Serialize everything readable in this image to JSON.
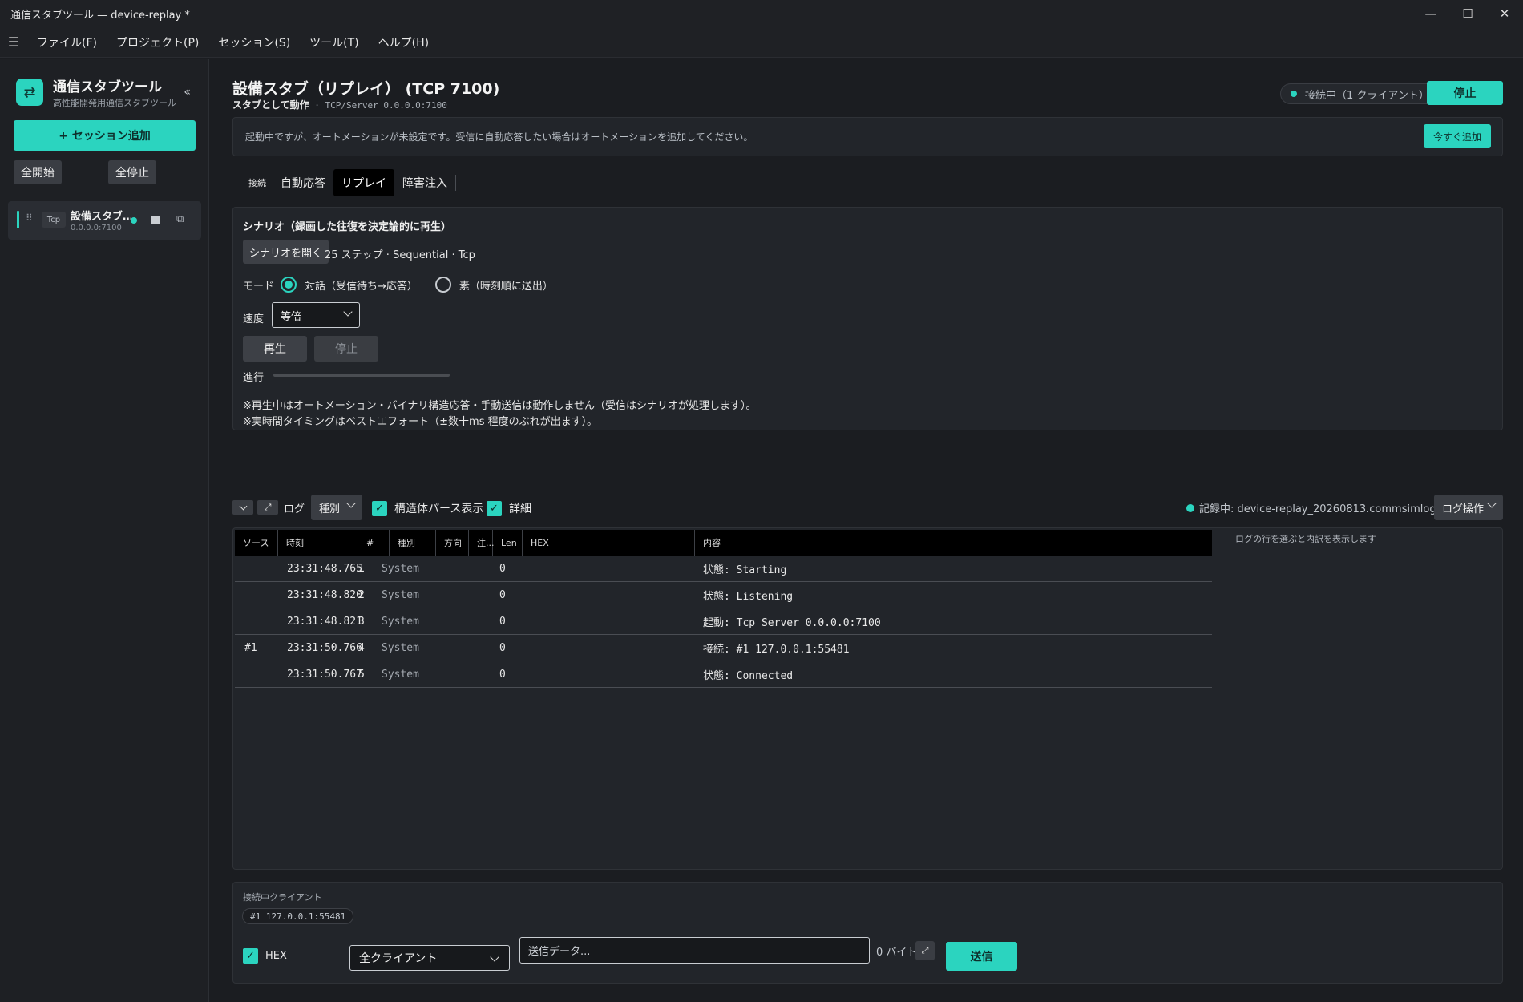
{
  "window": {
    "title": "通信スタブツール — device-replay *",
    "controls": [
      "—",
      "☐",
      "✕"
    ]
  },
  "menu": [
    "ファイル(F)",
    "プロジェクト(P)",
    "セッション(S)",
    "ツール(T)",
    "ヘルプ(H)"
  ],
  "sidebar": {
    "brand_title": "通信スタブツール",
    "brand_sub": "高性能開発用通信スタブツール",
    "collapse": "«",
    "add_session": "+ セッション追加",
    "start_all": "全開始",
    "stop_all": "全停止",
    "session": {
      "proto": "Tcp",
      "name": "設備スタブ…",
      "addr": "0.0.0.0:7100"
    }
  },
  "header": {
    "title": "設備スタブ（リプレイ） (TCP 7100)",
    "sub_bold": "スタブとして動作",
    "sub_endpoint": " · TCP/Server 0.0.0.0:7100",
    "status": "接続中（1 クライアント）",
    "stop": "停止"
  },
  "notice": {
    "text": "起動中ですが、オートメーションが未設定です。受信に自動応答したい場合はオートメーションを追加してください。",
    "button": "今すぐ追加"
  },
  "tabs": [
    "接続",
    "自動応答",
    "リプレイ",
    "障害注入"
  ],
  "replay": {
    "title": "シナリオ（録画した往復を決定論的に再生）",
    "open_button": "シナリオを開く",
    "scenario_info": "25 ステップ · Sequential · Tcp",
    "mode_label": "モード",
    "mode_dialog": "対話（受信待ち→応答）",
    "mode_raw": "素（時刻順に送出）",
    "speed_label": "速度",
    "speed_value": "等倍",
    "play": "再生",
    "stop": "停止",
    "progress_label": "進行",
    "progress": 0,
    "note1": "※再生中はオートメーション・バイナリ構造応答・手動送信は動作しません（受信はシナリオが処理します）。",
    "note2": "※実時間タイミングはベストエフォート（±数十ms 程度のぶれが出ます）。"
  },
  "log": {
    "label": "ログ",
    "kind_filter": "種別",
    "struct_parse": "構造体パース表示",
    "detail": "詳細",
    "recording": "記録中: device-replay_20260813.commsimlog",
    "ops": "ログ操作",
    "detail_hint": "ログの行を選ぶと内訳を表示します",
    "columns": [
      "ソース",
      "時刻",
      "#",
      "種別",
      "方向",
      "注...",
      "Len",
      "HEX",
      "内容"
    ],
    "rows": [
      {
        "src": "",
        "time": "23:31:48.765",
        "num": "1",
        "kind": "System",
        "dir": "",
        "note": "",
        "len": "0",
        "hex": "",
        "content": "状態: Starting"
      },
      {
        "src": "",
        "time": "23:31:48.820",
        "num": "2",
        "kind": "System",
        "dir": "",
        "note": "",
        "len": "0",
        "hex": "",
        "content": "状態: Listening"
      },
      {
        "src": "",
        "time": "23:31:48.821",
        "num": "3",
        "kind": "System",
        "dir": "",
        "note": "",
        "len": "0",
        "hex": "",
        "content": "起動: Tcp Server 0.0.0.0:7100"
      },
      {
        "src": "#1",
        "time": "23:31:50.766",
        "num": "4",
        "kind": "System",
        "dir": "",
        "note": "",
        "len": "0",
        "hex": "",
        "content": "接続: #1 127.0.0.1:55481"
      },
      {
        "src": "",
        "time": "23:31:50.767",
        "num": "5",
        "kind": "System",
        "dir": "",
        "note": "",
        "len": "0",
        "hex": "",
        "content": "状態: Connected"
      }
    ]
  },
  "send": {
    "clients_label": "接続中クライアント",
    "client_chip": "#1 127.0.0.1:55481",
    "hex_label": "HEX",
    "target": "全クライアント",
    "placeholder": "送信データ...",
    "bytes": "0 バイト",
    "send": "送信"
  },
  "colors": {
    "accent": "#2bd4bf",
    "background": "#1b1d21",
    "panel": "#22252a"
  }
}
